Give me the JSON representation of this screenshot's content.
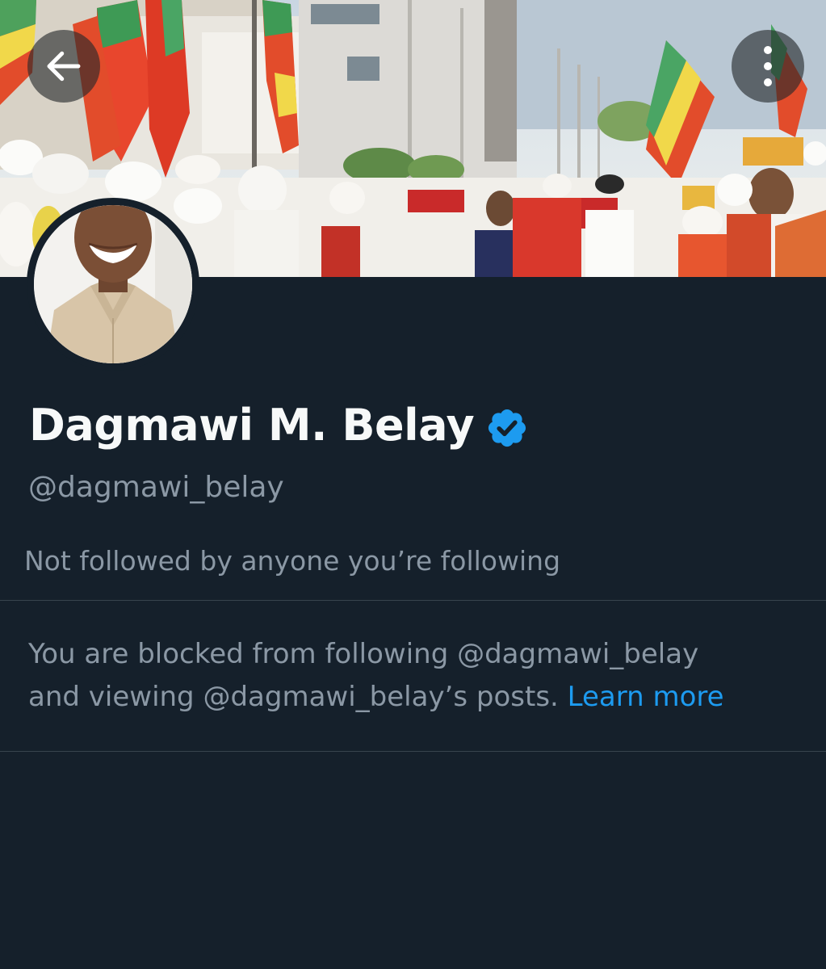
{
  "profile": {
    "display_name": "Dagmawi M. Belay",
    "handle": "@dagmawi_belay",
    "followers_note": "Not followed by anyone you’re following"
  },
  "blocked": {
    "line1": "You are blocked from following @dagmawi_belay",
    "line2_prefix": "and viewing @dagmawi_belay’s posts.",
    "learn_more": "Learn more"
  },
  "icons": {
    "back": "arrow-left-icon",
    "more": "more-vertical-icon",
    "verified": "verified-badge-icon"
  },
  "colors": {
    "background": "#15202b",
    "primary_text": "#f7f9f9",
    "secondary_text": "#8b98a5",
    "link": "#1d9bf0",
    "verified": "#1d9bf0",
    "divider": "#38444d"
  }
}
